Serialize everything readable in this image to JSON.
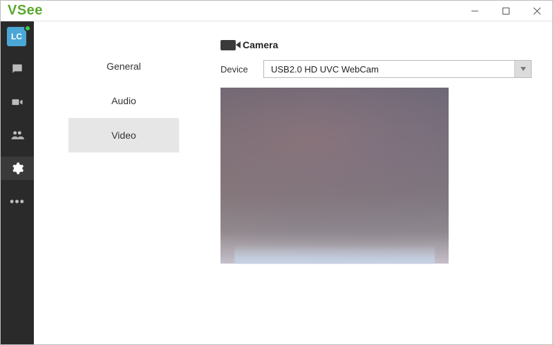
{
  "app": {
    "name_v": "V",
    "name_see": "See"
  },
  "window_controls": {
    "minimize": "—",
    "maximize": "□",
    "close": "✕"
  },
  "sidebar": {
    "avatar_initials": "LC",
    "icons": {
      "chat": "chat-icon",
      "video": "video-icon",
      "contacts": "contacts-icon",
      "settings": "settings-icon",
      "more": "more-icon"
    }
  },
  "settings_nav": {
    "items": [
      {
        "label": "General",
        "selected": false
      },
      {
        "label": "Audio",
        "selected": false
      },
      {
        "label": "Video",
        "selected": true
      }
    ]
  },
  "camera": {
    "section_title": "Camera",
    "device_label": "Device",
    "device_selected": "USB2.0 HD UVC WebCam"
  }
}
